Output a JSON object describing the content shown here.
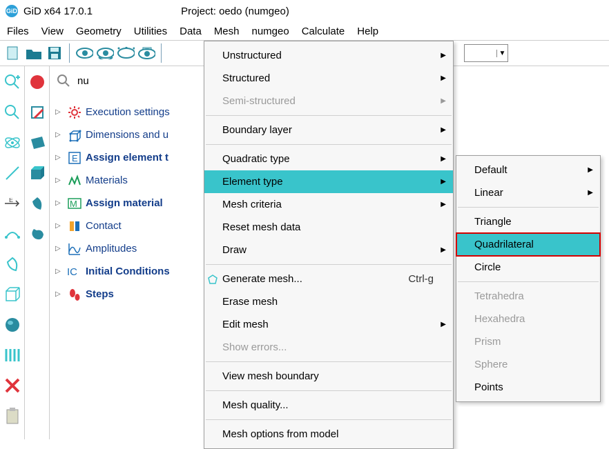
{
  "title": {
    "app": "GiD x64 17.0.1",
    "project": "Project: oedo (numgeo)"
  },
  "menubar": [
    "Files",
    "View",
    "Geometry",
    "Utilities",
    "Data",
    "Mesh",
    "numgeo",
    "Calculate",
    "Help"
  ],
  "search_value": "nu",
  "tree": [
    {
      "label": "Execution settings",
      "bold": false,
      "icon": "gear"
    },
    {
      "label": "Dimensions and u",
      "bold": false,
      "icon": "dimensions"
    },
    {
      "label": "Assign element t",
      "bold": true,
      "icon": "letter-E"
    },
    {
      "label": "Materials",
      "bold": false,
      "icon": "materials"
    },
    {
      "label": "Assign material",
      "bold": true,
      "icon": "letter-M"
    },
    {
      "label": "Contact",
      "bold": false,
      "icon": "contact"
    },
    {
      "label": "Amplitudes",
      "bold": false,
      "icon": "amplitudes"
    },
    {
      "label": "Initial Conditions",
      "bold": true,
      "icon": "letter-IC"
    },
    {
      "label": "Steps",
      "bold": true,
      "icon": "steps"
    }
  ],
  "mesh_menu": [
    {
      "label": "Unstructured",
      "arrow": true
    },
    {
      "label": "Structured",
      "arrow": true
    },
    {
      "label": "Semi-structured",
      "arrow": true,
      "disabled": true
    },
    {
      "sep": true
    },
    {
      "label": "Boundary layer",
      "arrow": true
    },
    {
      "sep": true
    },
    {
      "label": "Quadratic type",
      "arrow": true
    },
    {
      "label": "Element type",
      "arrow": true,
      "highlight": true
    },
    {
      "label": "Mesh criteria",
      "arrow": true
    },
    {
      "label": "Reset mesh data"
    },
    {
      "label": "Draw",
      "arrow": true
    },
    {
      "sep": true
    },
    {
      "label": "Generate mesh...",
      "shortcut": "Ctrl-g",
      "lefticon": true
    },
    {
      "label": "Erase mesh"
    },
    {
      "label": "Edit mesh",
      "arrow": true
    },
    {
      "label": "Show errors...",
      "disabled": true
    },
    {
      "sep": true
    },
    {
      "label": "View mesh boundary"
    },
    {
      "sep": true
    },
    {
      "label": "Mesh quality..."
    },
    {
      "sep": true
    },
    {
      "label": "Mesh options from model"
    }
  ],
  "element_menu": [
    {
      "label": "Default",
      "arrow": true
    },
    {
      "label": "Linear",
      "arrow": true
    },
    {
      "sep": true
    },
    {
      "label": "Triangle"
    },
    {
      "label": "Quadrilateral",
      "selected_box": true
    },
    {
      "label": "Circle"
    },
    {
      "sep": true
    },
    {
      "label": "Tetrahedra",
      "disabled": true
    },
    {
      "label": "Hexahedra",
      "disabled": true
    },
    {
      "label": "Prism",
      "disabled": true
    },
    {
      "label": "Sphere",
      "disabled": true
    },
    {
      "label": "Points"
    }
  ]
}
